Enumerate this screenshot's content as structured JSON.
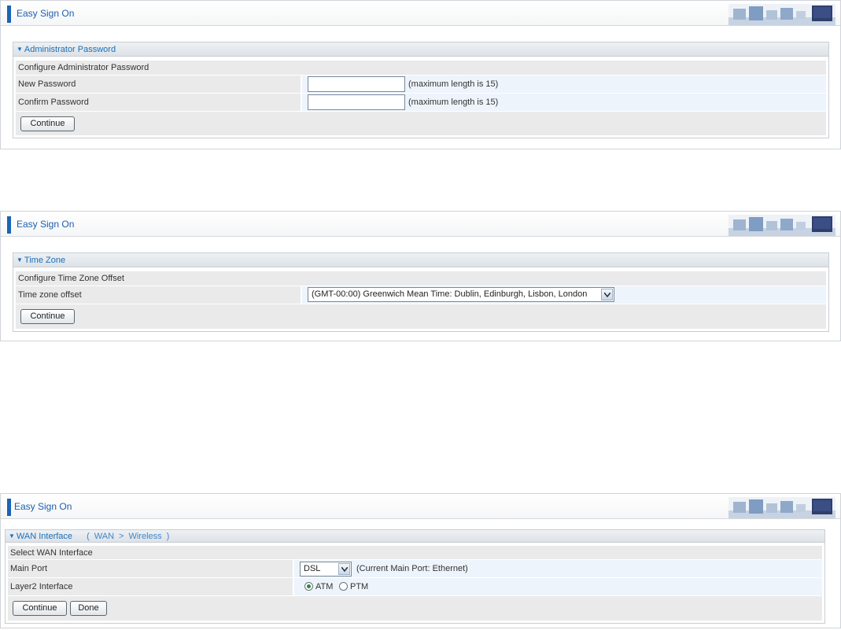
{
  "screens": [
    {
      "title": "Easy Sign On",
      "panel_title": "Administrator Password",
      "section": "Configure Administrator Password",
      "new_password_label": "New Password",
      "confirm_password_label": "Confirm Password",
      "new_password_value": "",
      "confirm_password_value": "",
      "hint": "(maximum length is 15)",
      "continue_label": "Continue"
    },
    {
      "title": "Easy Sign On",
      "panel_title": "Time Zone",
      "section": "Configure Time Zone Offset",
      "tz_label": "Time zone offset",
      "tz_value": "(GMT-00:00) Greenwich Mean Time: Dublin, Edinburgh, Lisbon, London",
      "continue_label": "Continue"
    },
    {
      "title": "Easy Sign On",
      "panel_title": "WAN Interface",
      "crumb_wan": "WAN",
      "crumb_sep": ">",
      "crumb_wireless": "Wireless",
      "crumb_open": "(",
      "crumb_close": ")",
      "section": "Select WAN Interface",
      "main_port_label": "Main Port",
      "main_port_value": "DSL",
      "current_port": "(Current Main Port: Ethernet)",
      "layer2_label": "Layer2 Interface",
      "radio_atm": "ATM",
      "radio_ptm": "PTM",
      "selected_layer2": "ATM",
      "continue_label": "Continue",
      "done_label": "Done"
    }
  ],
  "colors": {
    "accent": "#1b63b5",
    "title": "#1b5fb0",
    "panel_title": "#1b6fb8"
  },
  "icons": {
    "panel_toggle": "triangle-down-icon",
    "banner": "office-chairs-banner",
    "select_arrow": "chevron-down-icon"
  }
}
